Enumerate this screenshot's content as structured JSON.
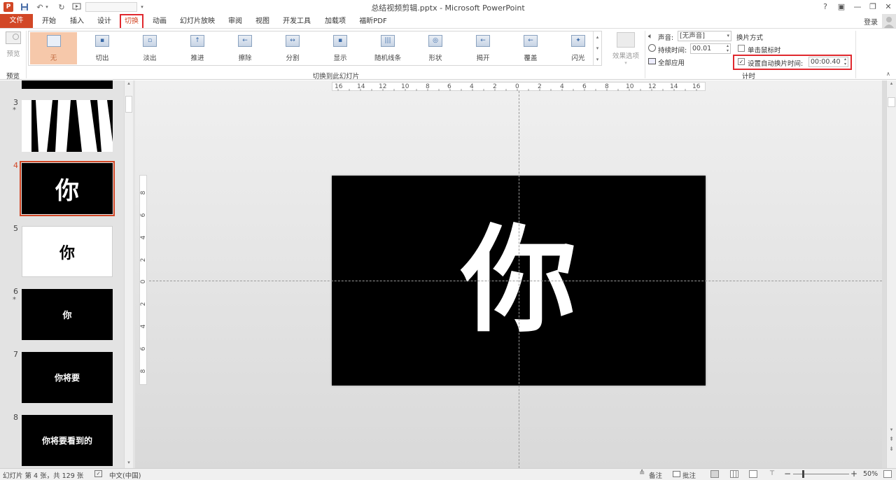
{
  "app": {
    "title": "总结视频剪辑.pptx - Microsoft PowerPoint",
    "help": "?",
    "login": "登录"
  },
  "qat": {
    "save": "save-icon",
    "undo": "undo-icon",
    "redo": "redo-icon",
    "customize": "▾"
  },
  "tabs": [
    {
      "label": "文件"
    },
    {
      "label": "开始"
    },
    {
      "label": "插入"
    },
    {
      "label": "设计"
    },
    {
      "label": "切换"
    },
    {
      "label": "动画"
    },
    {
      "label": "幻灯片放映"
    },
    {
      "label": "审阅"
    },
    {
      "label": "视图"
    },
    {
      "label": "开发工具"
    },
    {
      "label": "加载项"
    },
    {
      "label": "福昕PDF"
    }
  ],
  "ribbon": {
    "preview": {
      "button": "预览",
      "group": "预览"
    },
    "transitions": [
      {
        "label": "无",
        "glyph": ""
      },
      {
        "label": "切出",
        "glyph": "▪"
      },
      {
        "label": "淡出",
        "glyph": "▫"
      },
      {
        "label": "推进",
        "glyph": "↑"
      },
      {
        "label": "擦除",
        "glyph": "←"
      },
      {
        "label": "分割",
        "glyph": "↔"
      },
      {
        "label": "显示",
        "glyph": "▪"
      },
      {
        "label": "随机线条",
        "glyph": "|||"
      },
      {
        "label": "形状",
        "glyph": "◎"
      },
      {
        "label": "揭开",
        "glyph": "←"
      },
      {
        "label": "覆盖",
        "glyph": "←"
      },
      {
        "label": "闪光",
        "glyph": "✦"
      }
    ],
    "group_transitions": "切换到此幻灯片",
    "effect_options": "效果选项",
    "sound_label": "声音:",
    "sound_value": "[无声音]",
    "duration_label": "持续时间:",
    "duration_value": "00.01",
    "apply_all": "全部应用",
    "advance_title": "换片方式",
    "on_click_label": "单击鼠标时",
    "auto_label": "设置自动换片时间:",
    "auto_value": "00:00.40",
    "auto_check": "✓",
    "group_timing": "计时"
  },
  "thumbnails": [
    {
      "num": "3",
      "star": "*",
      "text": ""
    },
    {
      "num": "4",
      "star": "",
      "text": "你"
    },
    {
      "num": "5",
      "star": "",
      "text": "你"
    },
    {
      "num": "6",
      "star": "*",
      "text": "你"
    },
    {
      "num": "7",
      "star": "",
      "text": "你将要"
    },
    {
      "num": "8",
      "star": "",
      "text": "你将要看到的"
    }
  ],
  "ruler": {
    "h_labels": [
      "16",
      "14",
      "12",
      "10",
      "8",
      "6",
      "4",
      "2",
      "0",
      "2",
      "4",
      "6",
      "8",
      "10",
      "12",
      "14",
      "16"
    ],
    "v_labels": [
      "8",
      "6",
      "4",
      "2",
      "0",
      "2",
      "4",
      "6",
      "8"
    ]
  },
  "slide": {
    "text": "你"
  },
  "status": {
    "slide_info": "幻灯片 第 4 张，共 129 张",
    "language": "中文(中国)",
    "notes": "备注",
    "comments": "批注",
    "zoom": "50%",
    "minus": "−",
    "plus": "+"
  },
  "colors": {
    "accent": "#D24726",
    "highlight": "#E0282E",
    "slide_bg": "#000000"
  }
}
